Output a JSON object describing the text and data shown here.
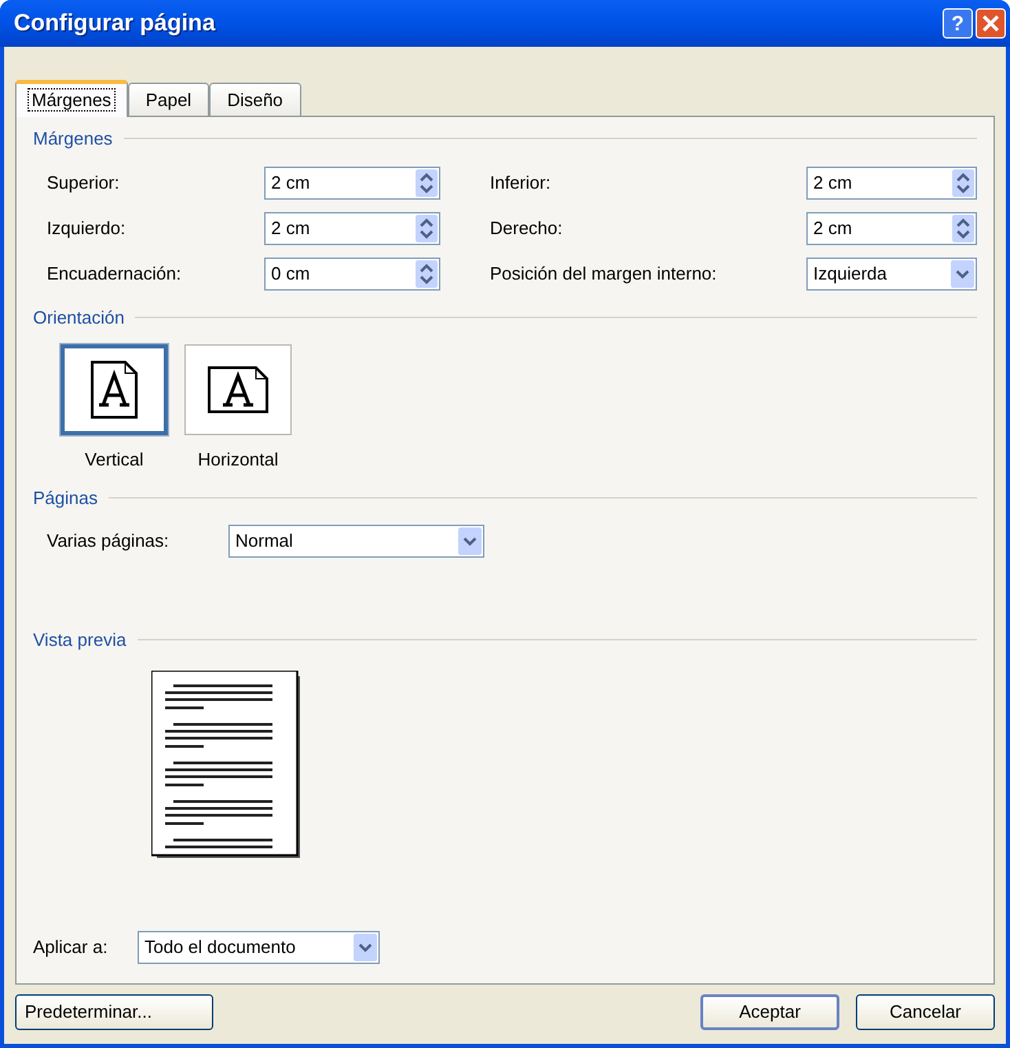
{
  "window": {
    "title": "Configurar página",
    "help_button": "?"
  },
  "tabs": [
    {
      "label": "Márgenes",
      "selected": true
    },
    {
      "label": "Papel",
      "selected": false
    },
    {
      "label": "Diseño",
      "selected": false
    }
  ],
  "margins": {
    "title": "Márgenes",
    "fields": [
      {
        "kind": "spinner",
        "label": "Superior:",
        "value": "2 cm"
      },
      {
        "kind": "spinner",
        "label": "Inferior:",
        "value": "2 cm"
      },
      {
        "kind": "spinner",
        "label": "Izquierdo:",
        "value": "2 cm"
      },
      {
        "kind": "spinner",
        "label": "Derecho:",
        "value": "2 cm"
      },
      {
        "kind": "spinner",
        "label": "Encuadernación:",
        "value": "0 cm"
      },
      {
        "kind": "dropdown",
        "label": "Posición del margen interno:",
        "value": "Izquierda"
      }
    ]
  },
  "orientation": {
    "title": "Orientación",
    "options": [
      {
        "label": "Vertical",
        "kind": "portrait",
        "selected": true
      },
      {
        "label": "Horizontal",
        "kind": "landscape",
        "selected": false
      }
    ]
  },
  "pages": {
    "title": "Páginas",
    "label": "Varias páginas:",
    "value": "Normal"
  },
  "preview": {
    "title": "Vista previa",
    "apply_label": "Aplicar a:",
    "apply_value": "Todo el documento"
  },
  "buttons": {
    "left": "Predeterminar...",
    "ok": "Aceptar",
    "cancel": "Cancelar"
  }
}
